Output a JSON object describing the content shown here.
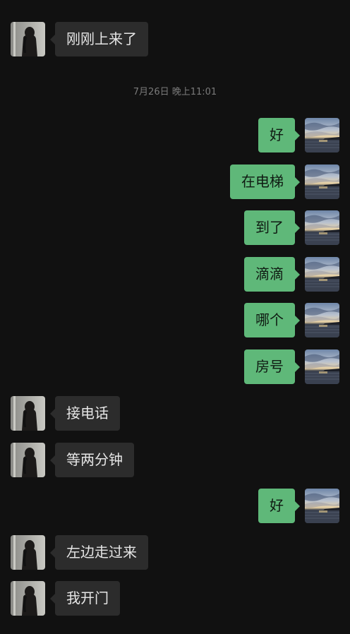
{
  "chat": {
    "timestamp": "7月26日 晚上11:01",
    "messages": [
      {
        "side": "in",
        "text": "刚刚上来了"
      },
      {
        "side": "out",
        "text": "好"
      },
      {
        "side": "out",
        "text": "在电梯"
      },
      {
        "side": "out",
        "text": "到了"
      },
      {
        "side": "out",
        "text": "滴滴"
      },
      {
        "side": "out",
        "text": "哪个"
      },
      {
        "side": "out",
        "text": "房号"
      },
      {
        "side": "in",
        "text": "接电话"
      },
      {
        "side": "in",
        "text": "等两分钟"
      },
      {
        "side": "out",
        "text": "好"
      },
      {
        "side": "in",
        "text": "左边走过来"
      },
      {
        "side": "in",
        "text": "我开门"
      }
    ]
  }
}
